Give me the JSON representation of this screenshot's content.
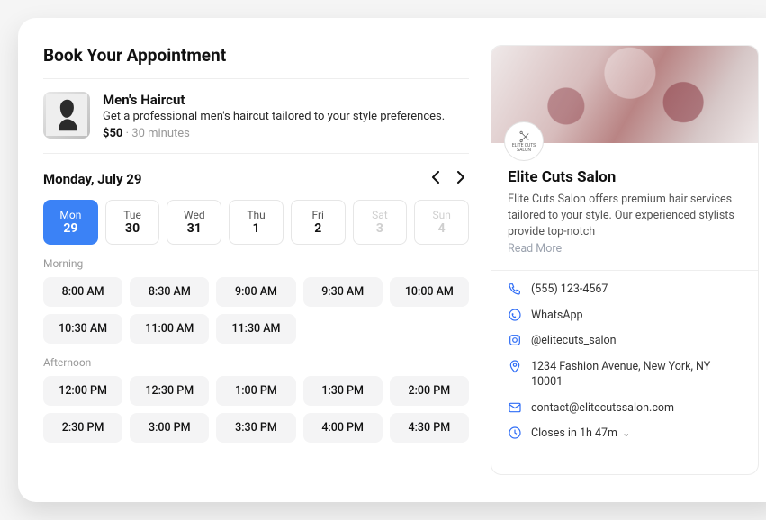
{
  "title": "Book Your Appointment",
  "service": {
    "name": "Men's Haircut",
    "desc": "Get a professional men's haircut tailored to your style preferences.",
    "price": "$50",
    "separator": "·",
    "duration": "30 minutes"
  },
  "calendar": {
    "label": "Monday, July 29",
    "days": [
      {
        "dow": "Mon",
        "num": "29",
        "selected": true,
        "disabled": false
      },
      {
        "dow": "Tue",
        "num": "30",
        "selected": false,
        "disabled": false
      },
      {
        "dow": "Wed",
        "num": "31",
        "selected": false,
        "disabled": false
      },
      {
        "dow": "Thu",
        "num": "1",
        "selected": false,
        "disabled": false
      },
      {
        "dow": "Fri",
        "num": "2",
        "selected": false,
        "disabled": false
      },
      {
        "dow": "Sat",
        "num": "3",
        "selected": false,
        "disabled": true
      },
      {
        "dow": "Sun",
        "num": "4",
        "selected": false,
        "disabled": true
      }
    ]
  },
  "sections": {
    "morning_label": "Morning",
    "afternoon_label": "Afternoon"
  },
  "slots": {
    "morning": [
      "8:00 AM",
      "8:30 AM",
      "9:00 AM",
      "9:30 AM",
      "10:00 AM",
      "10:30 AM",
      "11:00 AM",
      "11:30 AM"
    ],
    "afternoon": [
      "12:00 PM",
      "12:30 PM",
      "1:00 PM",
      "1:30 PM",
      "2:00 PM",
      "2:30 PM",
      "3:00 PM",
      "3:30 PM",
      "4:00 PM",
      "4:30 PM"
    ]
  },
  "business": {
    "name": "Elite Cuts Salon",
    "desc": "Elite Cuts Salon offers premium hair services tailored to your style. Our experienced stylists provide top-notch",
    "read_more": "Read More",
    "logo_text": "ELITE CUTS\nSALON"
  },
  "contacts": {
    "phone": "(555) 123-4567",
    "whatsapp": "WhatsApp",
    "instagram": "@elitecuts_salon",
    "address": "1234 Fashion Avenue, New York, NY 10001",
    "email": "contact@elitecutssalon.com",
    "hours": "Closes in 1h 47m"
  }
}
